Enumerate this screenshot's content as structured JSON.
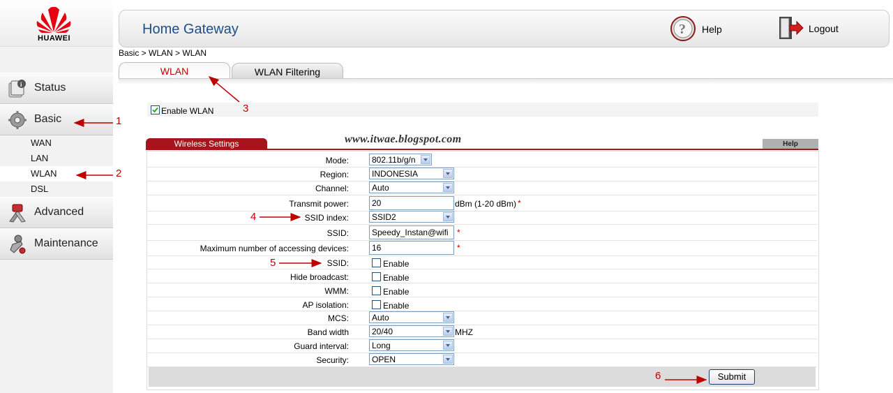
{
  "brand": {
    "name": "HUAWEI"
  },
  "header": {
    "title": "Home Gateway",
    "help_label": "Help",
    "logout_label": "Logout"
  },
  "sidebar": {
    "items": [
      {
        "label": "Status"
      },
      {
        "label": "Basic"
      },
      {
        "label": "Advanced"
      },
      {
        "label": "Maintenance"
      }
    ],
    "subitems": [
      {
        "label": "WAN"
      },
      {
        "label": "LAN"
      },
      {
        "label": "WLAN"
      },
      {
        "label": "DSL"
      }
    ]
  },
  "breadcrumb": "Basic > WLAN > WLAN",
  "tabs": [
    {
      "label": "WLAN"
    },
    {
      "label": "WLAN Filtering"
    }
  ],
  "enable_wlan": {
    "label": "Enable WLAN",
    "checked": true
  },
  "watermark": "www.itwae.blogspot.com",
  "section": {
    "title": "Wireless Settings",
    "help_label": "Help"
  },
  "form": {
    "mode": {
      "label": "Mode:",
      "value": "802.11b/g/n"
    },
    "region": {
      "label": "Region:",
      "value": "INDONESIA"
    },
    "channel": {
      "label": "Channel:",
      "value": "Auto"
    },
    "transmit_power": {
      "label": "Transmit power:",
      "value": "20",
      "unit": "dBm (1-20 dBm)",
      "required": "*"
    },
    "ssid_index": {
      "label": "SSID index:",
      "value": "SSID2"
    },
    "ssid": {
      "label": "SSID:",
      "value": "Speedy_Instan@wifi",
      "required": "*"
    },
    "max_devices": {
      "label": "Maximum number of accessing devices:",
      "value": "16",
      "required": "*"
    },
    "ssid_enable": {
      "label": "SSID:",
      "option": "Enable"
    },
    "hide_broadcast": {
      "label": "Hide broadcast:",
      "option": "Enable"
    },
    "wmm": {
      "label": "WMM:",
      "option": "Enable"
    },
    "ap_isolation": {
      "label": "AP isolation:",
      "option": "Enable"
    },
    "mcs": {
      "label": "MCS:",
      "value": "Auto"
    },
    "band_width": {
      "label": "Band width",
      "value": "20/40",
      "unit": "MHZ"
    },
    "guard_interval": {
      "label": "Guard interval:",
      "value": "Long"
    },
    "security": {
      "label": "Security:",
      "value": "OPEN"
    },
    "submit_label": "Submit"
  },
  "annotations": [
    "1",
    "2",
    "3",
    "4",
    "5",
    "6"
  ],
  "colors": {
    "accent_red": "#c00000",
    "title_blue": "#1e4f86",
    "section_red": "#a8141c"
  }
}
